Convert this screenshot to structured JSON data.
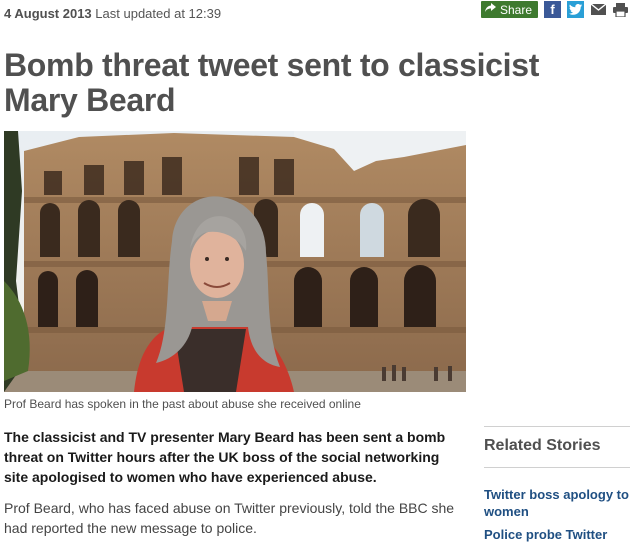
{
  "article": {
    "date": "4 August 2013",
    "updated": "Last updated at 12:39",
    "headline": "Bomb threat tweet sent to classicist Mary Beard",
    "image_caption": "Prof Beard has spoken in the past about abuse she received online",
    "intro": "The classicist and TV presenter Mary Beard has been sent a bomb threat on Twitter hours after the UK boss of the social networking site apologised to women who have experienced abuse.",
    "paragraph": "Prof Beard, who has faced abuse on Twitter previously, told the BBC she had reported the new message to police."
  },
  "share": {
    "label": "Share",
    "icons": [
      "share-arrow-icon",
      "facebook-icon",
      "twitter-icon",
      "email-icon",
      "print-icon"
    ],
    "colors": {
      "share": "#3e7a2f",
      "facebook": "#3b5998",
      "twitter": "#2a9fd6"
    }
  },
  "related": {
    "title": "Related Stories",
    "links": [
      "Twitter boss apology to women",
      "Police probe Twitter"
    ]
  },
  "colors": {
    "link": "#1f4f82",
    "headline": "#505050"
  }
}
